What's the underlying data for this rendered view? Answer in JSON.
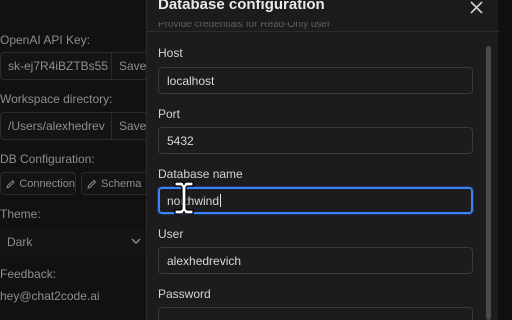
{
  "background": {
    "api_key_label": "OpenAI API Key:",
    "api_key_value": "sk-ej7R4iBZTBs55",
    "save_label": "Save",
    "workspace_label": "Workspace directory:",
    "workspace_value": "/Users/alexhedrev",
    "db_config_label": "DB Configuration:",
    "connection_button": "Connection",
    "schema_button": "Schema",
    "theme_label": "Theme:",
    "theme_value": "Dark",
    "feedback_label": "Feedback:",
    "feedback_email": "hey@chat2code.ai"
  },
  "dialog": {
    "title": "Database configuration",
    "close_icon": "close-icon",
    "subtitle": "Provide credentials for Read-Only user",
    "fields": {
      "host": {
        "label": "Host",
        "value": "localhost"
      },
      "port": {
        "label": "Port",
        "value": "5432"
      },
      "database": {
        "label": "Database name",
        "value": "northwind"
      },
      "user": {
        "label": "User",
        "value": "alexhedrevich"
      },
      "password": {
        "label": "Password",
        "value": ""
      }
    },
    "focus_color": "#3b82f6"
  }
}
